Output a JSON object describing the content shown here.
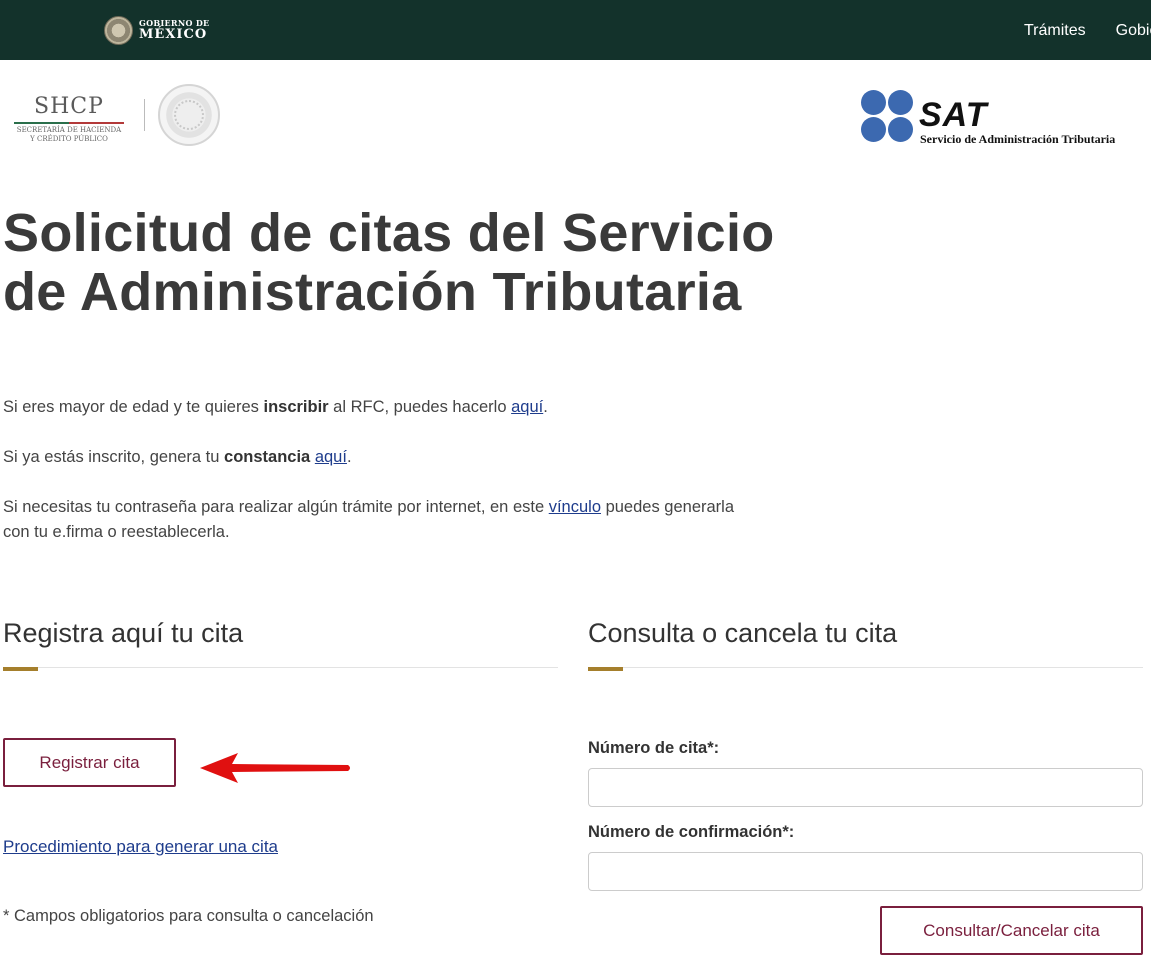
{
  "topbar": {
    "logo_small": "GOBIERNO DE",
    "logo_big": "MÉXICO",
    "nav": [
      "Trámites",
      "Gobierno"
    ],
    "background": "#13322b"
  },
  "logos": {
    "shcp_title": "SHCP",
    "shcp_sub_line1": "SECRETARÍA DE HACIENDA",
    "shcp_sub_line2": "Y CRÉDITO PÚBLICO",
    "sat_word": "SAT",
    "sat_sub": "Servicio de Administración Tributaria"
  },
  "page": {
    "title": "Solicitud de citas del Servicio de Administración Tributaria",
    "p1_before": "Si eres mayor de edad y te quieres ",
    "p1_bold": "inscribir",
    "p1_mid": " al RFC, puedes hacerlo ",
    "p1_link": "aquí",
    "p1_after": ".",
    "p2_before": "Si ya estás inscrito, genera tu ",
    "p2_bold": "constancia",
    "p2_mid": " ",
    "p2_link": "aquí",
    "p2_after": ".",
    "p3_before": "Si necesitas tu contraseña para realizar algún trámite por internet, en este ",
    "p3_link": "vínculo",
    "p3_after": " puedes generarla con tu e.firma o reestablecerla."
  },
  "register": {
    "title": "Registra aquí tu cita",
    "button": "Registrar cita",
    "procedure_link": "Procedimiento para generar una cita",
    "required_note": "* Campos obligatorios para consulta o cancelación"
  },
  "consult": {
    "title": "Consulta o cancela tu cita",
    "numero_cita_label": "Número de cita*:",
    "numero_cita_value": "",
    "numero_confirmacion_label": "Número de confirmación*:",
    "numero_confirmacion_value": "",
    "button": "Consultar/Cancelar cita"
  },
  "colors": {
    "accent_gold": "#a57f2c",
    "button_border": "#7a1f3d",
    "link": "#1e3c8c",
    "arrow": "#e01010",
    "sat_blue": "#3c69b0"
  }
}
